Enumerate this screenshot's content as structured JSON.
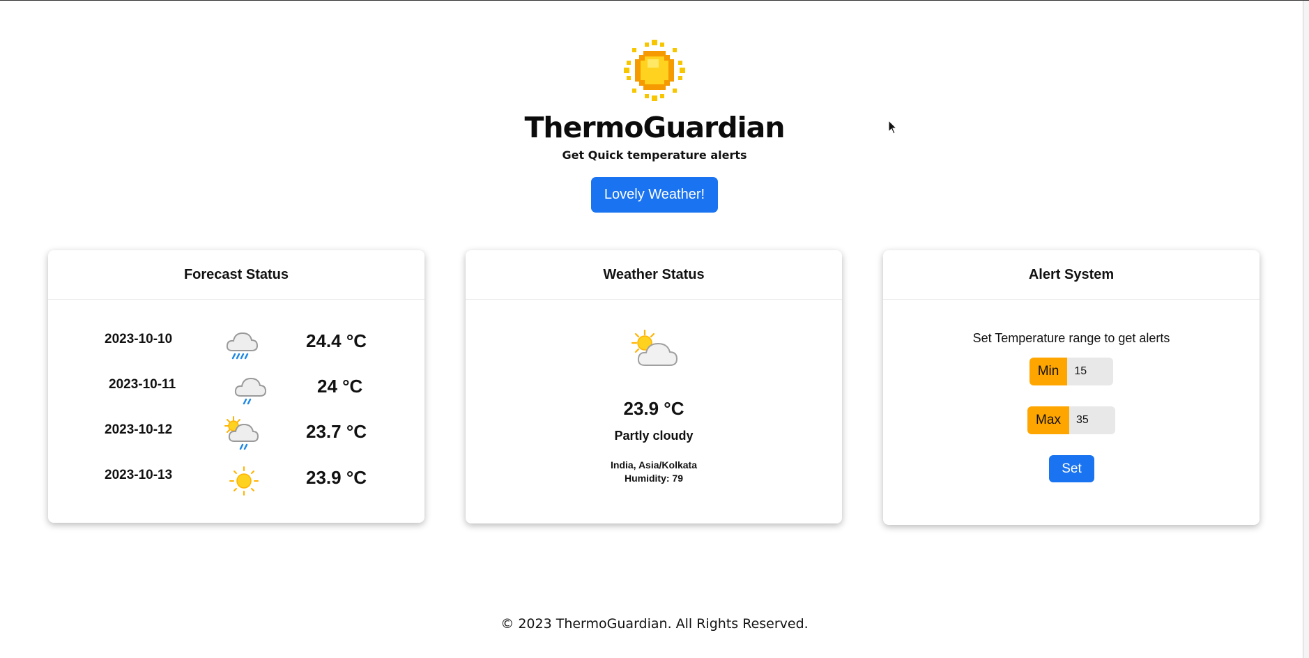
{
  "app": {
    "title": "ThermoGuardian",
    "subtitle": "Get Quick temperature alerts",
    "logo_icon": "sun-icon",
    "action_button": "Lovely Weather!"
  },
  "colors": {
    "primary": "#1a73f0",
    "accent": "#ffa500",
    "text": "#111111"
  },
  "forecast": {
    "title": "Forecast Status",
    "rows": [
      {
        "date": "2023-10-10",
        "icon": "heavy-rain-cloud-icon",
        "temp": "24.4 °C"
      },
      {
        "date": "2023-10-11",
        "icon": "light-rain-cloud-icon",
        "temp": "24 °C"
      },
      {
        "date": "2023-10-12",
        "icon": "sun-cloud-rain-icon",
        "temp": "23.7 °C"
      },
      {
        "date": "2023-10-13",
        "icon": "sunny-icon",
        "temp": "23.9 °C"
      }
    ]
  },
  "weather": {
    "title": "Weather Status",
    "icon": "partly-cloudy-icon",
    "temp": "23.9 °C",
    "condition": "Partly cloudy",
    "location": "India, Asia/Kolkata",
    "humidity": "Humidity: 79"
  },
  "alert": {
    "title": "Alert System",
    "instruction": "Set Temperature range to get alerts",
    "min_label": "Min",
    "min_value": "15",
    "max_label": "Max",
    "max_value": "35",
    "set_label": "Set"
  },
  "footer": {
    "text": "© 2023 ThermoGuardian. All Rights Reserved."
  }
}
